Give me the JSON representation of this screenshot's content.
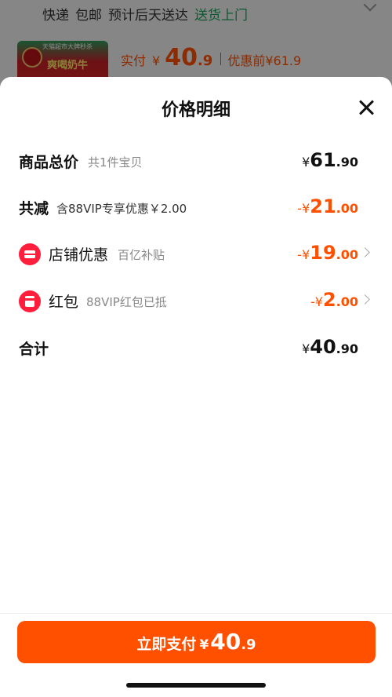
{
  "background": {
    "shipping": {
      "carrier": "快递",
      "fee": "包邮",
      "eta": "预计后天送达",
      "delivery": "送货上门"
    },
    "product_thumb_top_text": "天猫超市大牌秒杀",
    "product_thumb_text": "爽喝奶牛",
    "price": {
      "paid_label": "实付",
      "yen": "¥",
      "paid_int": "40",
      "paid_dec": ".9",
      "original_label": "优惠前",
      "original": "¥61.9"
    }
  },
  "sheet": {
    "title": "价格明细",
    "rows": {
      "total": {
        "label": "商品总价",
        "sub": "共1件宝贝",
        "yen": "¥",
        "int": "61",
        "dec": ".90"
      },
      "reduction": {
        "label": "共减",
        "sub": "含88VIP专享优惠￥2.00",
        "sign": "-¥",
        "int": "21",
        "dec": ".00"
      },
      "shop": {
        "label": "店铺优惠",
        "sub": "百亿补贴",
        "sign": "-¥",
        "int": "19",
        "dec": ".00"
      },
      "red_packet": {
        "label": "红包",
        "sub": "88VIP红包已抵",
        "sign": "-¥",
        "int": "2",
        "dec": ".00"
      },
      "sum": {
        "label": "合计",
        "yen": "¥",
        "int": "40",
        "dec": ".90"
      }
    },
    "pay_button": {
      "label": "立即支付",
      "yen": "¥",
      "int": "40",
      "dec": ".9"
    }
  },
  "colors": {
    "accent": "#ff5000",
    "icon_red": "#ff1e3c",
    "green": "#1aa35a"
  }
}
